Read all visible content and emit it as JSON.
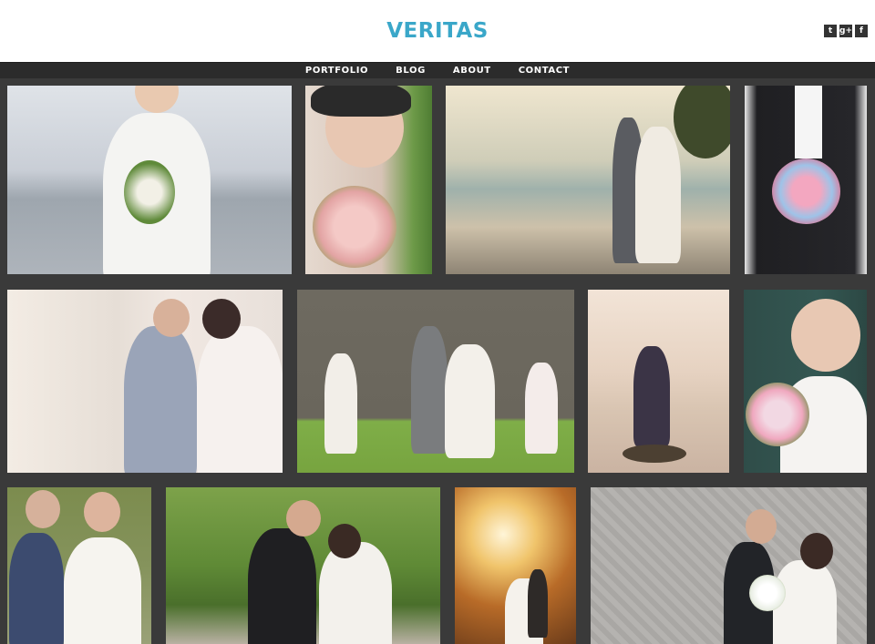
{
  "site": {
    "title": "VERITAS"
  },
  "social": [
    {
      "name": "twitter",
      "glyph": "t"
    },
    {
      "name": "google-plus",
      "glyph": "g+"
    },
    {
      "name": "facebook",
      "glyph": "f"
    }
  ],
  "nav": {
    "items": [
      "PORTFOLIO",
      "BLOG",
      "ABOUT",
      "CONTACT"
    ]
  },
  "colors": {
    "accent": "#3aa7c9",
    "nav_bg": "#2b2b2b",
    "page_bg": "#3a3a3a"
  },
  "gallery": {
    "photos": [
      {
        "subject": "bride holding bouquet by lake"
      },
      {
        "subject": "bride with veil and pink bouquet"
      },
      {
        "subject": "couple kissing by fountain"
      },
      {
        "subject": "groom holding bouquet"
      },
      {
        "subject": "couple with petals by balustrade"
      },
      {
        "subject": "wedding party jumping on lawn"
      },
      {
        "subject": "couple on rock by lake"
      },
      {
        "subject": "bride in birdcage veil smiling"
      },
      {
        "subject": "couple smiling portrait"
      },
      {
        "subject": "couple running in park"
      },
      {
        "subject": "couple in autumn forest"
      },
      {
        "subject": "couple on cobblestone"
      }
    ]
  }
}
